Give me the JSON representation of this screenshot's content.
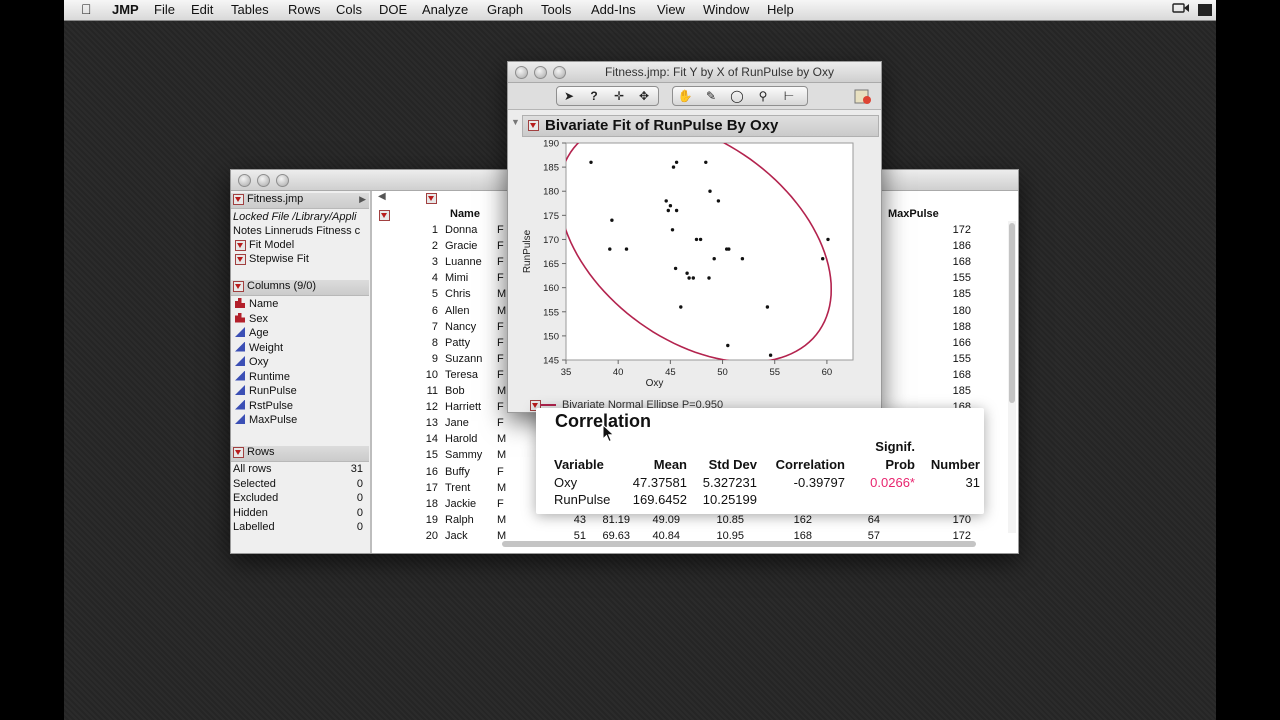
{
  "menubar": {
    "app": "JMP",
    "items": [
      "File",
      "Edit",
      "Tables",
      "Rows",
      "Cols",
      "DOE",
      "Analyze",
      "Graph",
      "Tools",
      "Add-Ins",
      "View",
      "Window",
      "Help"
    ]
  },
  "table_window": {
    "panel": {
      "table_name": "Fitness.jmp",
      "locked_file": "Locked File  /Library/Appli",
      "notes": "Notes  Linneruds Fitness c",
      "scripts": [
        "Fit Model",
        "Stepwise Fit"
      ],
      "columns_header": "Columns (9/0)",
      "columns": [
        {
          "name": "Name",
          "type": "nominal"
        },
        {
          "name": "Sex",
          "type": "nominal"
        },
        {
          "name": "Age",
          "type": "continuous"
        },
        {
          "name": "Weight",
          "type": "continuous"
        },
        {
          "name": "Oxy",
          "type": "continuous"
        },
        {
          "name": "Runtime",
          "type": "continuous"
        },
        {
          "name": "RunPulse",
          "type": "continuous"
        },
        {
          "name": "RstPulse",
          "type": "continuous"
        },
        {
          "name": "MaxPulse",
          "type": "continuous"
        }
      ],
      "rows_header": "Rows",
      "rows_summary": [
        {
          "label": "All rows",
          "value": "31"
        },
        {
          "label": "Selected",
          "value": "0"
        },
        {
          "label": "Excluded",
          "value": "0"
        },
        {
          "label": "Hidden",
          "value": "0"
        },
        {
          "label": "Labelled",
          "value": "0"
        }
      ]
    },
    "grid": {
      "headers": {
        "name": "Name",
        "maxpulse": "MaxPulse"
      },
      "rows": [
        {
          "n": "1",
          "name": "Donna",
          "sex": "F",
          "max": "172"
        },
        {
          "n": "2",
          "name": "Gracie",
          "sex": "F",
          "max": "186"
        },
        {
          "n": "3",
          "name": "Luanne",
          "sex": "F",
          "max": "168"
        },
        {
          "n": "4",
          "name": "Mimi",
          "sex": "F",
          "max": "155"
        },
        {
          "n": "5",
          "name": "Chris",
          "sex": "M",
          "max": "185"
        },
        {
          "n": "6",
          "name": "Allen",
          "sex": "M",
          "max": "180"
        },
        {
          "n": "7",
          "name": "Nancy",
          "sex": "F",
          "max": "188"
        },
        {
          "n": "8",
          "name": "Patty",
          "sex": "F",
          "max": "166"
        },
        {
          "n": "9",
          "name": "Suzann",
          "sex": "F",
          "max": "155"
        },
        {
          "n": "10",
          "name": "Teresa",
          "sex": "F",
          "max": "168"
        },
        {
          "n": "11",
          "name": "Bob",
          "sex": "M",
          "max": "185"
        },
        {
          "n": "12",
          "name": "Harriett",
          "sex": "F",
          "max": "168"
        },
        {
          "n": "13",
          "name": "Jane",
          "sex": "F",
          "max": "168"
        },
        {
          "n": "14",
          "name": "Harold",
          "sex": "M",
          "max": "164"
        },
        {
          "n": "15",
          "name": "Sammy",
          "sex": "M",
          "max": "170"
        },
        {
          "n": "16",
          "name": "Buffy",
          "sex": "F",
          "max": "188"
        },
        {
          "n": "17",
          "name": "Trent",
          "sex": "M",
          "max": "172"
        },
        {
          "n": "18",
          "name": "Jackie",
          "sex": "F",
          "max": "164"
        },
        {
          "n": "19",
          "name": "Ralph",
          "sex": "M",
          "age": "43",
          "weight": "81.19",
          "oxy": "49.09",
          "runtime": "10.85",
          "runpulse": "162",
          "rstpulse": "64",
          "max": "170"
        },
        {
          "n": "20",
          "name": "Jack",
          "sex": "M",
          "age": "51",
          "weight": "69.63",
          "oxy": "40.84",
          "runtime": "10.95",
          "runpulse": "168",
          "rstpulse": "57",
          "max": "172"
        }
      ]
    }
  },
  "report_window": {
    "title": "Fitness.jmp: Fit Y by X of RunPulse by Oxy",
    "tools": [
      "arrow-tool",
      "help-tool",
      "selection-tool",
      "crosshair-tool",
      "hand-tool",
      "brush-tool",
      "lasso-tool",
      "magnifier-tool",
      "annotate-tool"
    ],
    "outline_title": "Bivariate Fit of RunPulse By Oxy",
    "legend_label": "Bivariate Normal Ellipse P=0.950"
  },
  "chart_data": {
    "type": "scatter",
    "xlabel": "Oxy",
    "ylabel": "RunPulse",
    "xlim": [
      35,
      62.5
    ],
    "ylim": [
      145,
      190
    ],
    "xticks": [
      35,
      40,
      45,
      50,
      55,
      60
    ],
    "yticks": [
      145,
      150,
      155,
      160,
      165,
      170,
      175,
      180,
      185,
      190
    ],
    "grid": false,
    "points": [
      [
        37.4,
        186
      ],
      [
        39.2,
        168
      ],
      [
        39.4,
        174
      ],
      [
        40.8,
        168
      ],
      [
        44.6,
        178
      ],
      [
        44.8,
        176
      ],
      [
        45.0,
        177
      ],
      [
        45.2,
        172
      ],
      [
        45.3,
        185
      ],
      [
        45.5,
        164
      ],
      [
        45.6,
        186
      ],
      [
        45.6,
        176
      ],
      [
        46.0,
        156
      ],
      [
        46.6,
        163
      ],
      [
        46.8,
        162
      ],
      [
        47.2,
        162
      ],
      [
        47.5,
        170
      ],
      [
        47.9,
        170
      ],
      [
        48.4,
        186
      ],
      [
        48.7,
        162
      ],
      [
        48.8,
        180
      ],
      [
        49.2,
        166
      ],
      [
        49.6,
        178
      ],
      [
        50.4,
        168
      ],
      [
        50.5,
        148
      ],
      [
        50.6,
        168
      ],
      [
        51.9,
        166
      ],
      [
        54.3,
        156
      ],
      [
        54.6,
        146
      ],
      [
        59.6,
        166
      ],
      [
        60.1,
        170
      ]
    ],
    "ellipse": {
      "label": "Bivariate Normal Ellipse P=0.950",
      "center": [
        47.37581,
        169.6452
      ],
      "color": "#b3234e"
    }
  },
  "correlation": {
    "title": "Correlation",
    "headers": {
      "variable": "Variable",
      "mean": "Mean",
      "std": "Std Dev",
      "corr": "Correlation",
      "signif_top": "Signif.",
      "signif_bottom": "Prob",
      "number": "Number"
    },
    "rows": [
      {
        "variable": "Oxy",
        "mean": "47.37581",
        "std": "5.327231",
        "corr": "-0.39797",
        "prob": "0.0266*",
        "number": "31"
      },
      {
        "variable": "RunPulse",
        "mean": "169.6452",
        "std": "10.25199",
        "corr": "",
        "prob": "",
        "number": ""
      }
    ],
    "prob_color": "#e8256f"
  }
}
